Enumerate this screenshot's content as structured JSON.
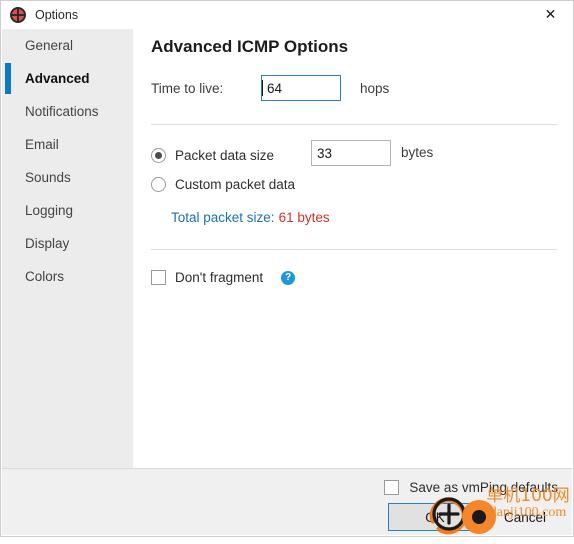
{
  "window": {
    "title": "Options",
    "icon": "target-crosshair-icon",
    "close_label": "✕",
    "accent_color": "#0b7ac6"
  },
  "sidebar": {
    "items": [
      {
        "label": "General",
        "selected": false
      },
      {
        "label": "Advanced",
        "selected": true
      },
      {
        "label": "Notifications",
        "selected": false
      },
      {
        "label": "Email",
        "selected": false
      },
      {
        "label": "Sounds",
        "selected": false
      },
      {
        "label": "Logging",
        "selected": false
      },
      {
        "label": "Display",
        "selected": false
      },
      {
        "label": "Colors",
        "selected": false
      }
    ]
  },
  "main": {
    "heading": "Advanced ICMP Options",
    "ttl": {
      "label": "Time to live:",
      "value": "64",
      "suffix": "hops"
    },
    "packet": {
      "size_radio_label": "Packet data size",
      "size_value": "33",
      "size_suffix": "bytes",
      "custom_radio_label": "Custom packet data",
      "total_label": "Total packet size:",
      "total_value": "61 bytes",
      "total_label_color": "#1d6fb8",
      "total_value_color": "#d9302a"
    },
    "fragment": {
      "label": "Don't fragment",
      "help_icon": "question-mark-help-icon",
      "help_glyph": "?"
    }
  },
  "footer": {
    "save_defaults_label": "Save as vmPing defaults",
    "ok_label": "OK",
    "cancel_label": "Cancel"
  },
  "watermark": {
    "line1": "单机100网",
    "line2": "danji100.com",
    "color": "#f08a2a"
  }
}
